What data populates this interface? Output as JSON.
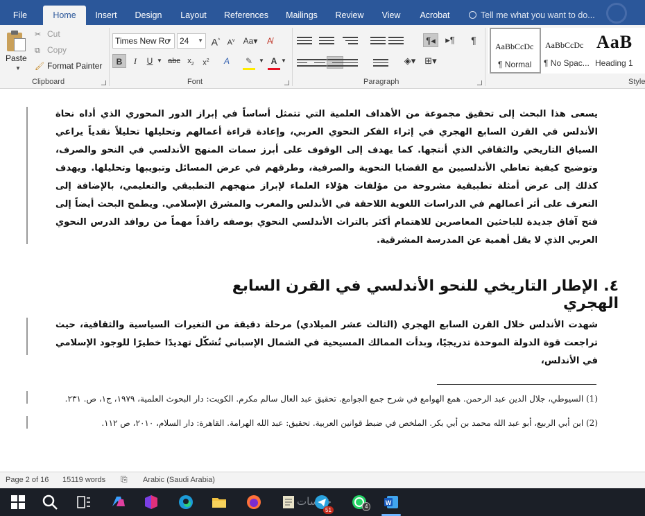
{
  "tabs": [
    {
      "label": "File"
    },
    {
      "label": "Home"
    },
    {
      "label": "Insert"
    },
    {
      "label": "Design"
    },
    {
      "label": "Layout"
    },
    {
      "label": "References"
    },
    {
      "label": "Mailings"
    },
    {
      "label": "Review"
    },
    {
      "label": "View"
    },
    {
      "label": "Acrobat"
    }
  ],
  "tell_me": "Tell me what you want to do...",
  "clipboard": {
    "paste": "Paste",
    "cut": "Cut",
    "copy": "Copy",
    "format_painter": "Format Painter",
    "label": "Clipboard"
  },
  "font": {
    "name": "Times New Ro",
    "size": "24",
    "label": "Font"
  },
  "paragraph": {
    "label": "Paragraph"
  },
  "styles": {
    "label": "Style",
    "items": [
      {
        "sample": "AaBbCcDc",
        "name": "¶ Normal"
      },
      {
        "sample": "AaBbCcDc",
        "name": "¶ No Spac..."
      },
      {
        "sample": "AaB",
        "name": "Heading 1"
      }
    ]
  },
  "document": {
    "para1": "يسعى هذا البحث إلى تحقيق مجموعة من الأهداف العلمية التي تتمثل أساساً في إبراز الدور المحوري الذي أداه نحاة الأندلس في القرن السابع الهجري في إثراء الفكر النحوي العربي، وإعادة قراءة أعمالهم وتحليلها تحليلاً نقدياً يراعي السياق التاريخي والثقافي الذي أنتجها. كما يهدف إلى الوقوف على أبرز سمات المنهج الأندلسي في النحو والصرف، وتوضيح كيفية تعاطي الأندلسيين مع القضايا النحوية والصرفية، وطرقهم في عرض المسائل وتبويبها وتحليلها. ويهدف كذلك إلى عرض أمثلة تطبيقية مشروحة من مؤلفات هؤلاء العلماء لإبراز منهجهم التطبيقي والتعليمي، بالإضافة إلى التعرف على أثر أعمالهم في الدراسات اللغوية اللاحقة في الأندلس والمغرب والمشرق الإسلامي. ويطمح البحث أيضاً إلى فتح آفاق جديدة للباحثين المعاصرين للاهتمام أكثر بالتراث الأندلسي النحوي بوصفه رافداً مهماً من روافد الدرس النحوي العربي الذي لا يقل أهمية عن المدرسة المشرقية.",
    "heading": "٤. الإطار التاريخي للنحو الأندلسي في القرن السابع الهجري",
    "para2": "شهدت الأندلس خلال القرن السابع الهجري (الثالث عشر الميلادي) مرحلة دقيقة من التغيرات السياسية والثقافية، حيث تراجعت قوة الدولة الموحدة تدريجيًا، وبدأت الممالك المسيحية في الشمال الإسباني تُشكّل تهديدًا خطيرًا للوجود الإسلامي في الأندلس،",
    "footnote1": "(1) السيوطي، جلال الدين عبد الرحمن. همع الهوامع في شرح جمع الجوامع. تحقيق عبد العال سالم مكرم. الكويت: دار البحوث العلمية، ١٩٧٩، ج١، ص. ٢٣١.",
    "footnote2": "(2) ابن أبي الربيع، أبو عبد الله محمد بن أبي بكر. الملخص في ضبط قوانين العربية. تحقيق: عبد الله الهرامة. القاهرة: دار السلام، ٢٠١٠، ص ١١٢."
  },
  "status": {
    "page": "Page 2 of 16",
    "words": "15119 words",
    "language": "Arabic (Saudi Arabia)"
  },
  "taskbar": {
    "watermark": "خمسات",
    "telegram_badge": "51",
    "whatsapp_badge": "4"
  },
  "colors": {
    "accent": "#2b579a",
    "word_blue": "#185abd"
  }
}
